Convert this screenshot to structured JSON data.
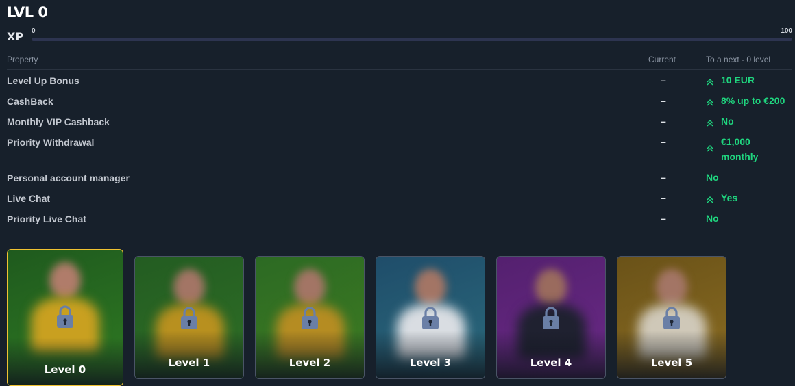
{
  "level": {
    "title": "LVL 0"
  },
  "xp": {
    "label": "XP",
    "min": "0",
    "max": "100",
    "progress": 0
  },
  "table": {
    "headers": {
      "property": "Property",
      "current": "Current",
      "next": "To a next - 0 level"
    },
    "rows": [
      {
        "label": "Level Up Bonus",
        "current": "–",
        "next": [
          "10 EUR"
        ],
        "arrow": true
      },
      {
        "label": "CashBack",
        "current": "–",
        "next": [
          "8% up to €200"
        ],
        "arrow": true
      },
      {
        "label": "Monthly VIP Cashback",
        "current": "–",
        "next": [
          "No"
        ],
        "arrow": true
      },
      {
        "label": "Priority Withdrawal",
        "current": "–",
        "next": [
          "€1,000",
          "monthly"
        ],
        "arrow": true
      },
      {
        "label": "Personal account manager",
        "current": "–",
        "next": [
          "No"
        ],
        "arrow": false
      },
      {
        "label": "Live Chat",
        "current": "–",
        "next": [
          "Yes"
        ],
        "arrow": true
      },
      {
        "label": "Priority Live Chat",
        "current": "–",
        "next": [
          "No"
        ],
        "arrow": false
      }
    ]
  },
  "colors": {
    "accent_green": "#1fd67f",
    "active_border": "#f0c232",
    "background": "#17202b"
  },
  "icons": {
    "up_arrow": "double-chevron-up-icon",
    "lock": "padlock-icon"
  },
  "cards": [
    {
      "name": "Level 0",
      "active": true,
      "locked": true,
      "bg": [
        "#1f5a1e",
        "#2f7a22"
      ],
      "shirt": "#c9a020",
      "face": "#b07c6a"
    },
    {
      "name": "Level 1",
      "active": false,
      "locked": true,
      "bg": [
        "#235c22",
        "#2f6f25"
      ],
      "shirt": "#b8901f",
      "face": "#a37565"
    },
    {
      "name": "Level 2",
      "active": false,
      "locked": true,
      "bg": [
        "#2c6a23",
        "#3e7b22"
      ],
      "shirt": "#b58c22",
      "face": "#a37565"
    },
    {
      "name": "Level 3",
      "active": false,
      "locked": true,
      "bg": [
        "#1f4d6a",
        "#2b6a7c"
      ],
      "shirt": "#d9dde2",
      "face": "#a37565"
    },
    {
      "name": "Level 4",
      "active": false,
      "locked": true,
      "bg": [
        "#54206f",
        "#6a2a86"
      ],
      "shirt": "#1f2130",
      "face": "#9a6b5e"
    },
    {
      "name": "Level 5",
      "active": false,
      "locked": true,
      "bg": [
        "#6a5218",
        "#8a6c22"
      ],
      "shirt": "#cfc8b8",
      "face": "#a37565"
    }
  ]
}
